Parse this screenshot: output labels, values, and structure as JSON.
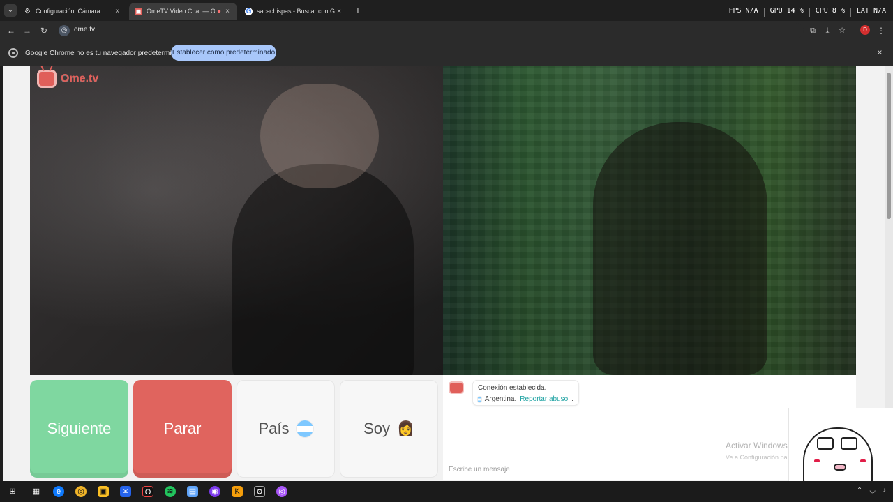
{
  "browser": {
    "tabs": [
      {
        "label": "Configuración: Cámara",
        "icon": "gear-icon"
      },
      {
        "label": "OmeTV Video Chat — Ome",
        "icon": "ometv-icon"
      },
      {
        "label": "sacachispas - Buscar con Goog",
        "icon": "google-icon"
      }
    ],
    "new_tab_label": "+",
    "address": "ome.tv",
    "infobar": {
      "text": "Google Chrome no es tu navegador predeterminado",
      "button": "Establecer como predeterminado"
    },
    "profile_initial": "D"
  },
  "perf_overlay": {
    "fps_label": "FPS",
    "fps_value": "N/A",
    "gpu_label": "GPU",
    "gpu_value": "14 %",
    "cpu_label": "CPU",
    "cpu_value": "8 %",
    "lat_label": "LAT",
    "lat_value": "N/A"
  },
  "ometv": {
    "logo_text": "Ome.tv",
    "buttons": {
      "next": "Siguiente",
      "stop": "Parar",
      "country": "País",
      "soy": "Soy",
      "country_icon": "argentina-flag-icon",
      "soy_icon": "person-emoji-icon",
      "soy_emoji": "👩"
    },
    "chat": {
      "status": "Conexión establecida.",
      "country": "Argentina.",
      "report": "Reportar abuso",
      "report_suffix": ".",
      "placeholder": "Escribe un mensaje"
    }
  },
  "windows_watermark": {
    "title": "Activar Windows",
    "subtitle": "Ve a Configuración para activar Windows."
  },
  "colors": {
    "next": "#7fd7a0",
    "stop": "#e0645e",
    "ome_red": "#e05f5a",
    "link": "#1ba1a1"
  }
}
